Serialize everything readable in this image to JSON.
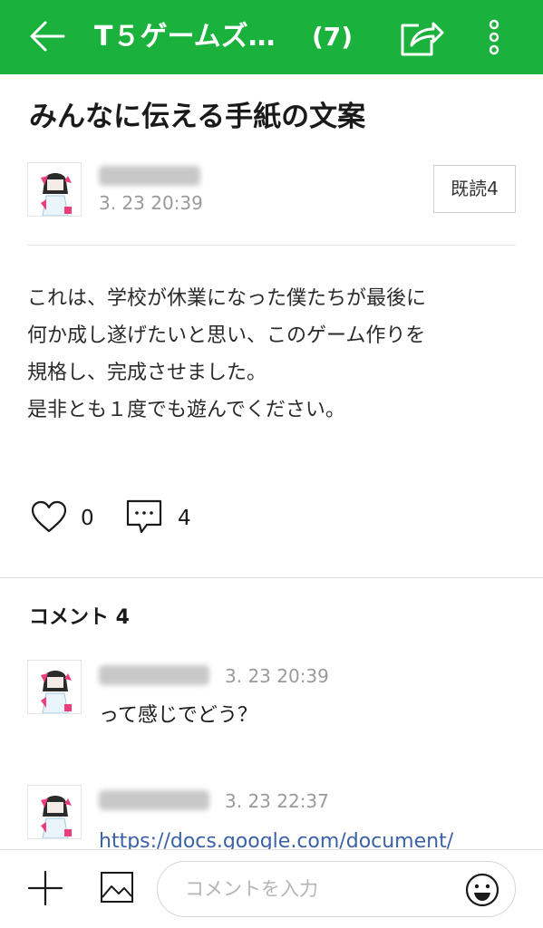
{
  "header": {
    "title": "T５ゲームズ…",
    "count": "(7)",
    "bg_color": "#1ab23c",
    "back_icon": "back-arrow-icon",
    "share_icon": "share-icon",
    "more_icon": "more-vertical-icon"
  },
  "post": {
    "title": "みんなに伝える手紙の文案",
    "time": "3. 23 20:39",
    "read_badge": "既読4",
    "body_lines": [
      "これは、学校が休業になった僕たちが最後に",
      "何か成し遂げたいと思い、このゲーム作りを",
      "規格し、完成させました。",
      "是非とも１度でも遊んでください。"
    ],
    "like_count": "0",
    "comment_count": "4"
  },
  "comments": {
    "heading": "コメント 4",
    "items": [
      {
        "time": "3. 23 20:39",
        "text": "って感じでどう？"
      },
      {
        "time": "3. 23 22:37",
        "text": "https://docs.google.com/document/"
      }
    ]
  },
  "bottom": {
    "placeholder": "コメントを入力",
    "link_color": "#3b62a6"
  }
}
